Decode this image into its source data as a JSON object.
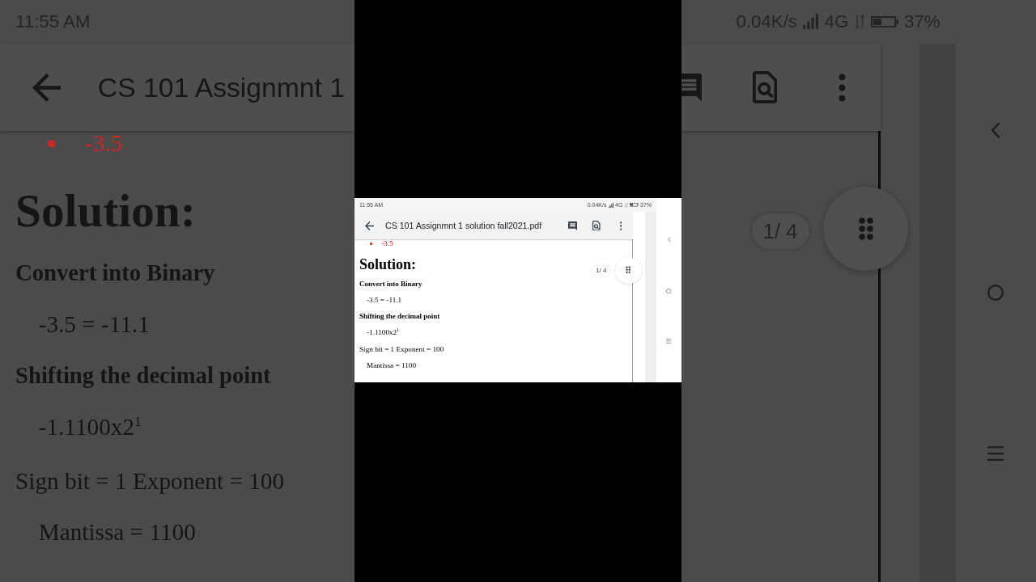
{
  "backdrop_left": {
    "status_bar": {
      "time": "11:55 AM"
    },
    "app_bar": {
      "title": "CS 101 Assignmnt 1"
    },
    "document": [
      {
        "kind": "bullet",
        "text": "-3.5"
      },
      {
        "kind": "title",
        "text": "Solution:"
      },
      {
        "kind": "heading",
        "text": "Convert into Binary"
      },
      {
        "kind": "indented",
        "text": "-3.5 = -11.1"
      },
      {
        "kind": "heading",
        "text": "Shifting the decimal point"
      },
      {
        "kind": "indented",
        "text": "-1.1100x2$^{1}$"
      },
      {
        "kind": "plain",
        "text": "Sign bit = 1 Exponent = 100"
      },
      {
        "kind": "indented",
        "text": "Mantissa = 1100"
      }
    ]
  },
  "screen": {
    "status_bar": {
      "time": "11:55 AM",
      "speed": "0.04K/s",
      "network": "4G",
      "battery": "37%"
    },
    "app_bar": {
      "title": "CS 101 Assignmnt 1 solution fall2021.pdf"
    },
    "document": [
      {
        "kind": "bullet",
        "text": "-3.5"
      },
      {
        "kind": "title",
        "text": "Solution:"
      },
      {
        "kind": "heading",
        "text": "Convert into Binary"
      },
      {
        "kind": "indented",
        "text": "-3.5 = -11.1"
      },
      {
        "kind": "heading",
        "text": "Shifting the decimal point"
      },
      {
        "kind": "indented",
        "text": "-1.1100x2$^{1}$"
      },
      {
        "kind": "plain",
        "text": "Sign bit = 1 Exponent = 100"
      },
      {
        "kind": "indented",
        "text": "Mantissa = 1100"
      }
    ],
    "page_indicator": "1/ 4"
  },
  "backdrop_right": {
    "status_bar": {
      "speed": "0.04K/s",
      "network": "4G",
      "battery": "37%"
    },
    "page_indicator": "1/ 4"
  }
}
